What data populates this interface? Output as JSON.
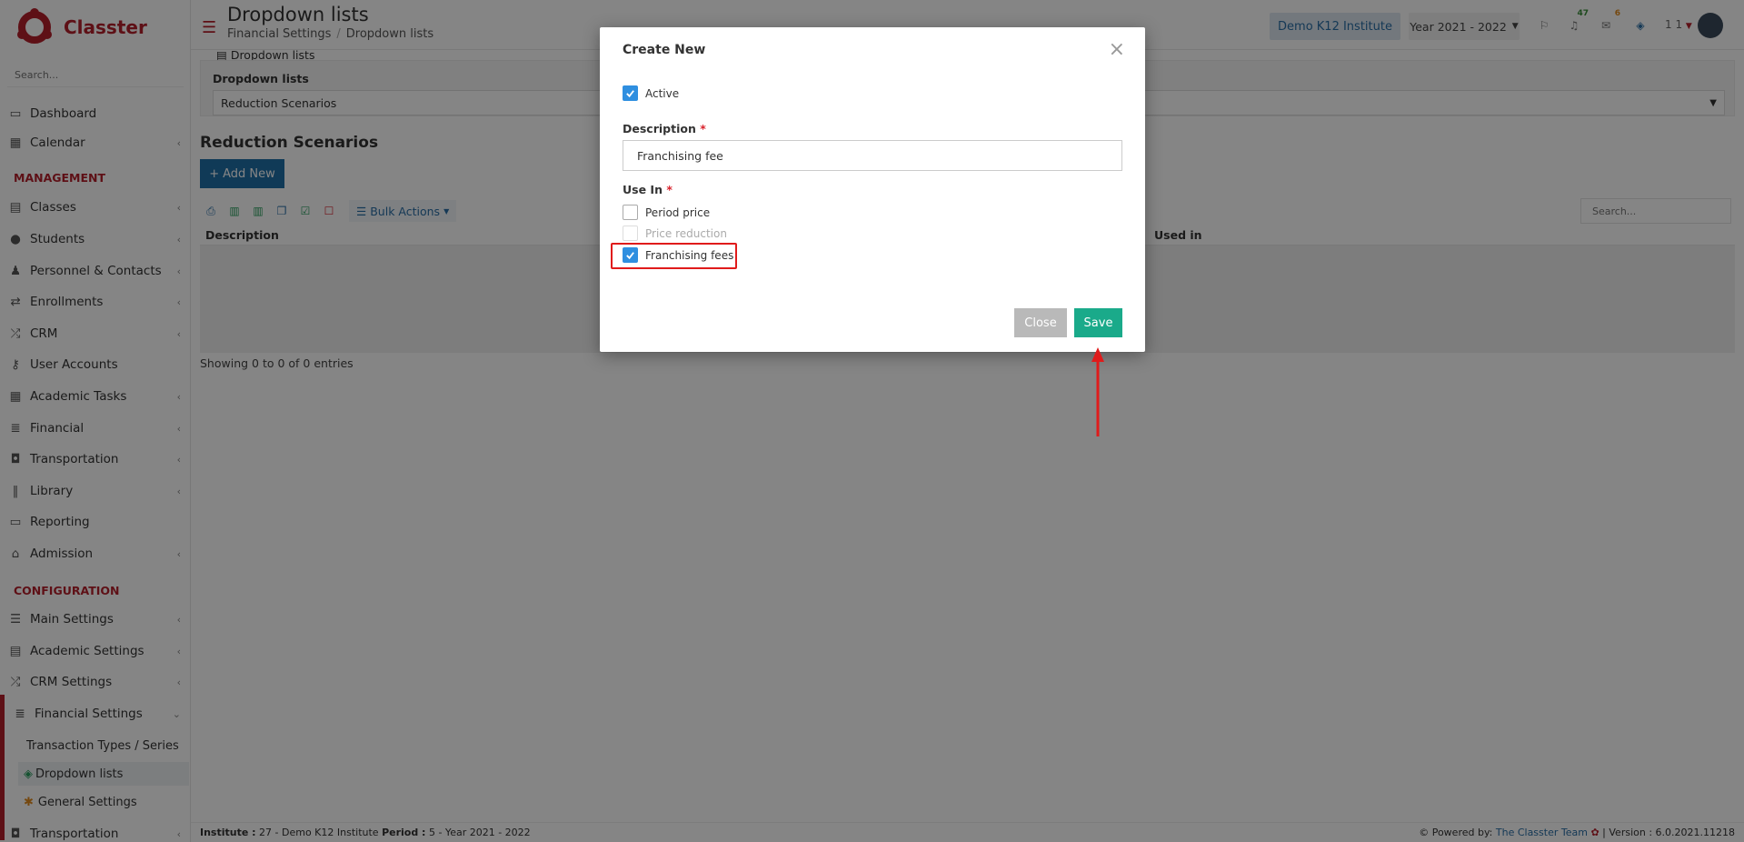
{
  "app": {
    "brand": "Classter",
    "accent": "#b51f2b"
  },
  "sidebar": {
    "search_placeholder": "Search...",
    "items": [
      {
        "label": "Dashboard",
        "icon": "laptop-icon"
      },
      {
        "label": "Calendar",
        "icon": "calendar-icon"
      },
      {
        "label": "Classes",
        "icon": "classes-icon"
      },
      {
        "label": "Students",
        "icon": "students-icon"
      },
      {
        "label": "Personnel & Contacts",
        "icon": "person-icon"
      },
      {
        "label": "Enrollments",
        "icon": "exchange-icon"
      },
      {
        "label": "CRM",
        "icon": "crm-icon"
      },
      {
        "label": "User Accounts",
        "icon": "key-icon"
      },
      {
        "label": "Academic Tasks",
        "icon": "grid-icon"
      },
      {
        "label": "Financial",
        "icon": "coins-icon"
      },
      {
        "label": "Transportation",
        "icon": "bus-icon"
      },
      {
        "label": "Library",
        "icon": "books-icon"
      },
      {
        "label": "Reporting",
        "icon": "printer-icon"
      },
      {
        "label": "Admission",
        "icon": "institution-icon"
      },
      {
        "label": "Main Settings",
        "icon": "sliders-icon"
      },
      {
        "label": "Academic Settings",
        "icon": "classes-icon"
      },
      {
        "label": "CRM Settings",
        "icon": "crm-icon"
      },
      {
        "label": "Financial Settings",
        "icon": "coins-icon"
      },
      {
        "label": "Transportation",
        "icon": "bus-icon"
      }
    ],
    "section_management": "MANAGEMENT",
    "section_configuration": "CONFIGURATION",
    "sub_items": [
      {
        "label": "Transaction Types / Series"
      },
      {
        "label": "Dropdown lists"
      },
      {
        "label": "General Settings"
      }
    ]
  },
  "header": {
    "title": "Dropdown lists",
    "breadcrumb": [
      "Financial Settings",
      "Dropdown lists"
    ],
    "institute": "Demo K12 Institute",
    "year": "Year 2021 - 2022",
    "notifications_count": "47",
    "messages_count": "6",
    "user_label": "1 1"
  },
  "main": {
    "panel_tab": "Dropdown lists",
    "dropdown_label": "Dropdown lists",
    "dropdown_value": "Reduction Scenarios",
    "section_title": "Reduction Scenarios",
    "add_new": "Add New",
    "bulk_actions": "Bulk Actions",
    "table_search_placeholder": "Search...",
    "columns": [
      "Description",
      "Used in"
    ],
    "entries_text": "Showing 0 to 0 of 0 entries"
  },
  "modal": {
    "title": "Create New",
    "active_label": "Active",
    "active_checked": true,
    "description_label": "Description",
    "description_value": "Franchising fee",
    "use_in_label": "Use In",
    "required_mark": "*",
    "options": [
      {
        "label": "Period price",
        "checked": false,
        "disabled": false
      },
      {
        "label": "Price reduction",
        "checked": false,
        "disabled": true
      },
      {
        "label": "Franchising fees",
        "checked": true,
        "disabled": false
      }
    ],
    "close_label": "Close",
    "save_label": "Save"
  },
  "footer": {
    "institute_key": "Institute :",
    "institute_value": "27 - Demo K12 Institute",
    "period_key": "Period :",
    "period_value": "5 - Year 2021 - 2022",
    "powered_by": "Powered by:",
    "team": "The Classter Team",
    "version": "| Version : 6.0.2021.11218"
  }
}
